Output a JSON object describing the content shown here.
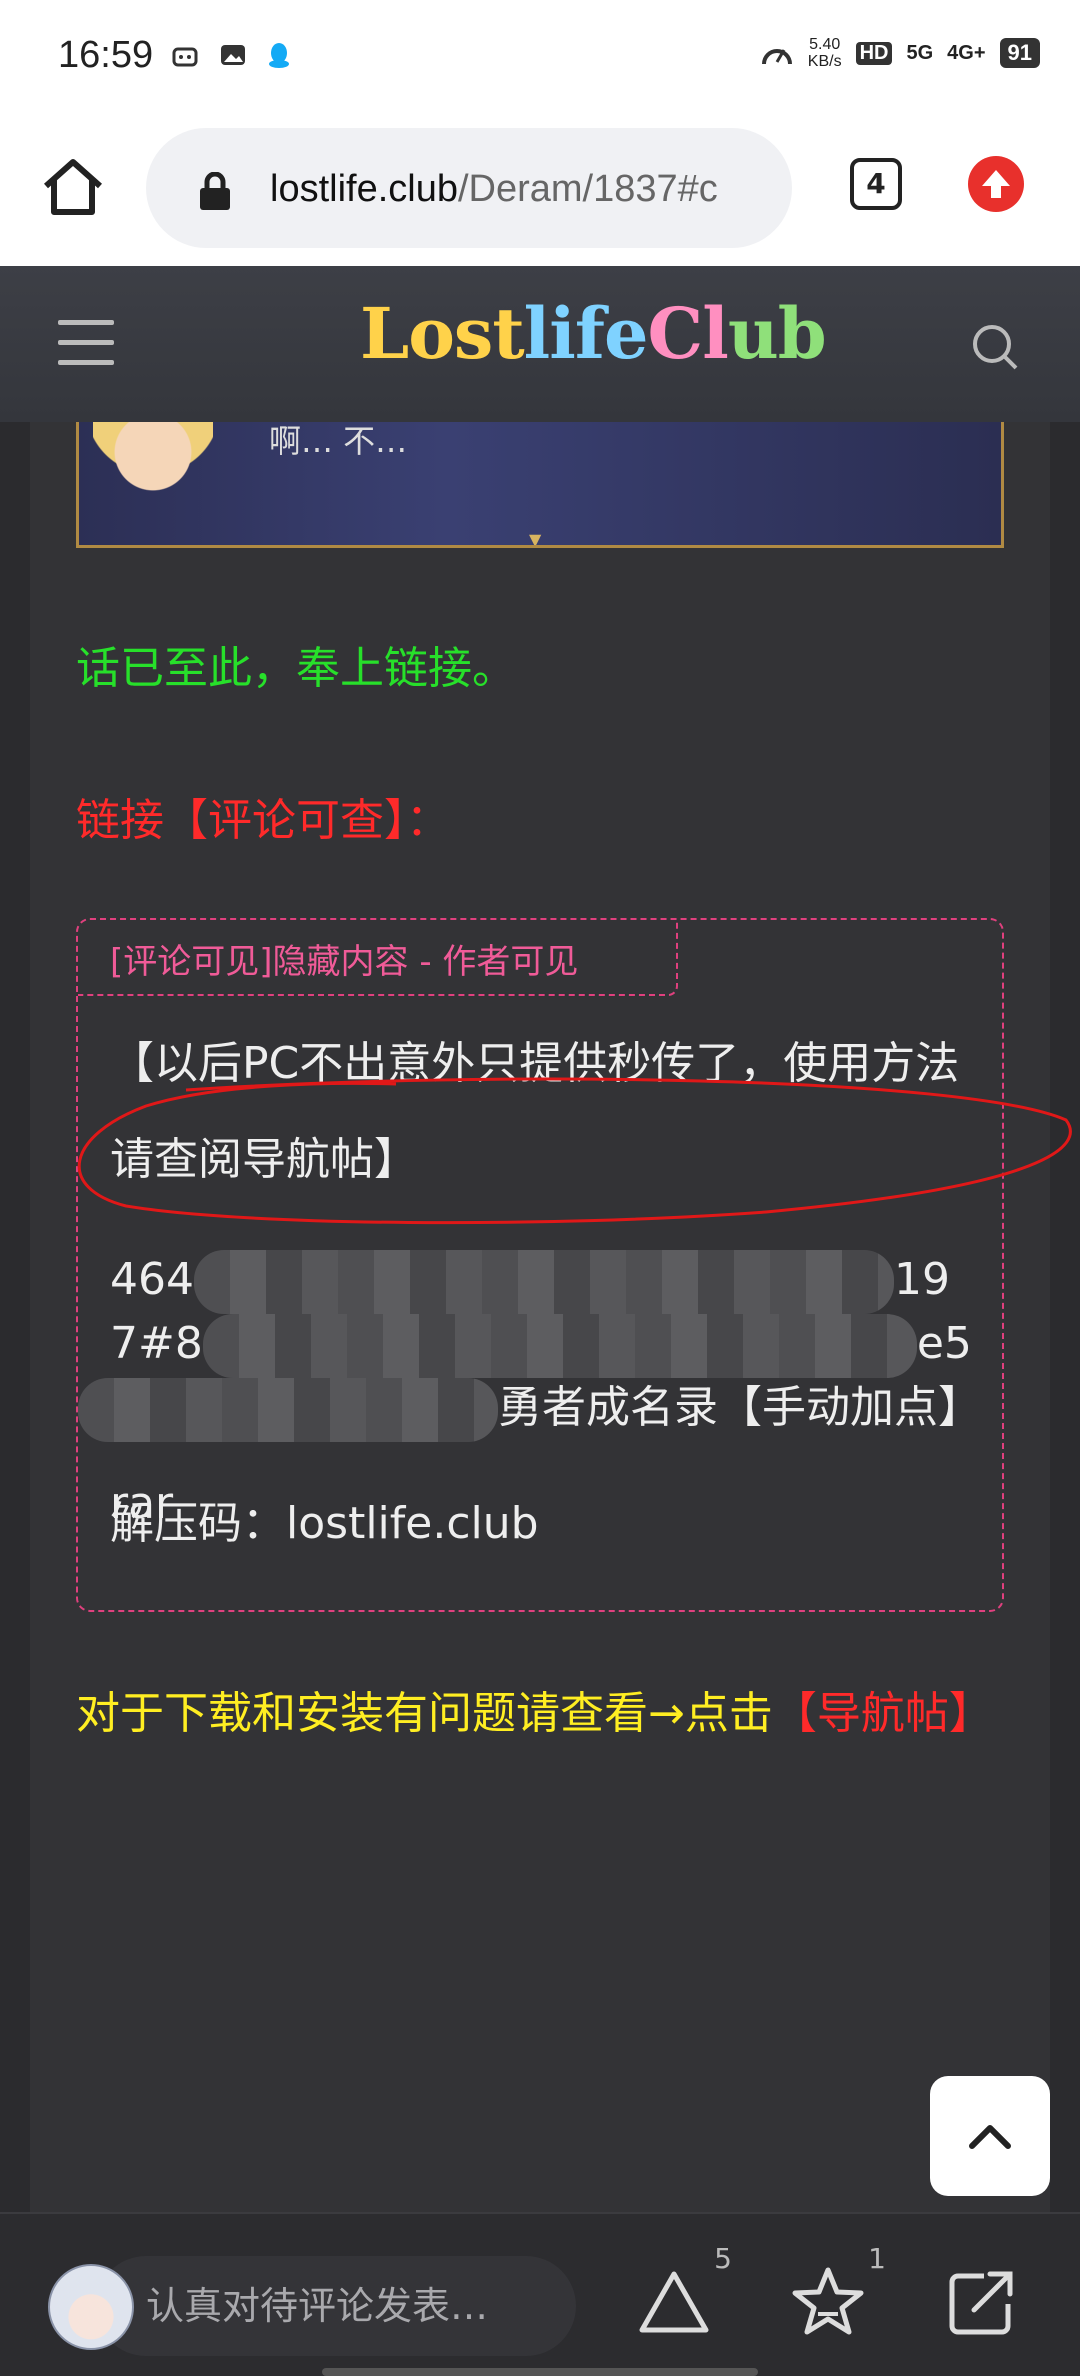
{
  "status_bar": {
    "time": "16:59",
    "net_speed_value": "5.40",
    "net_speed_unit": "KB/s",
    "hd_label": "HD",
    "sim1_label": "5G",
    "sim2_label": "4G+",
    "battery": "91"
  },
  "browser": {
    "url_domain": "lostlife.club",
    "url_path": "/Deram/1837#c",
    "tab_count": "4"
  },
  "site": {
    "logo": {
      "part1": "Lost",
      "part2": "life",
      "part3": "Cl",
      "part4": "ub"
    }
  },
  "post": {
    "banner_text": "啊…  不…",
    "line_intro": "话已至此，奉上链接。",
    "link_label": "链接【评论可查】：",
    "hidden_tag": "[评论可见]隐藏内容 - 作者可见",
    "notice": "【以后PC不出意外只提供秒传了，使用方法请查阅导航帖】",
    "code_line1_start": "464",
    "code_line1_end": "19",
    "code_line2_start": "7#8",
    "code_line2_end": "e5",
    "code_line3_end": "勇者成名录【手动加点】rar",
    "unzip": "解压码：lostlife.club",
    "help_text": "对于下载和安装有问题请查看→点击",
    "help_link": "【导航帖】"
  },
  "bottom_bar": {
    "comment_placeholder": "认真对待评论发表…",
    "like_count": "5",
    "fav_count": "1"
  },
  "colors": {
    "green_text": "#27e02a",
    "red_text": "#ff2a2a",
    "yellow_text": "#ffee22",
    "hidden_border": "#e0407e",
    "annotation_circle": "#e01818"
  },
  "icons": [
    "home-icon",
    "lock-icon",
    "tab-switcher-icon",
    "update-icon",
    "menu-icon",
    "search-icon",
    "back-to-top-icon",
    "like-icon",
    "favorite-icon",
    "share-icon"
  ]
}
